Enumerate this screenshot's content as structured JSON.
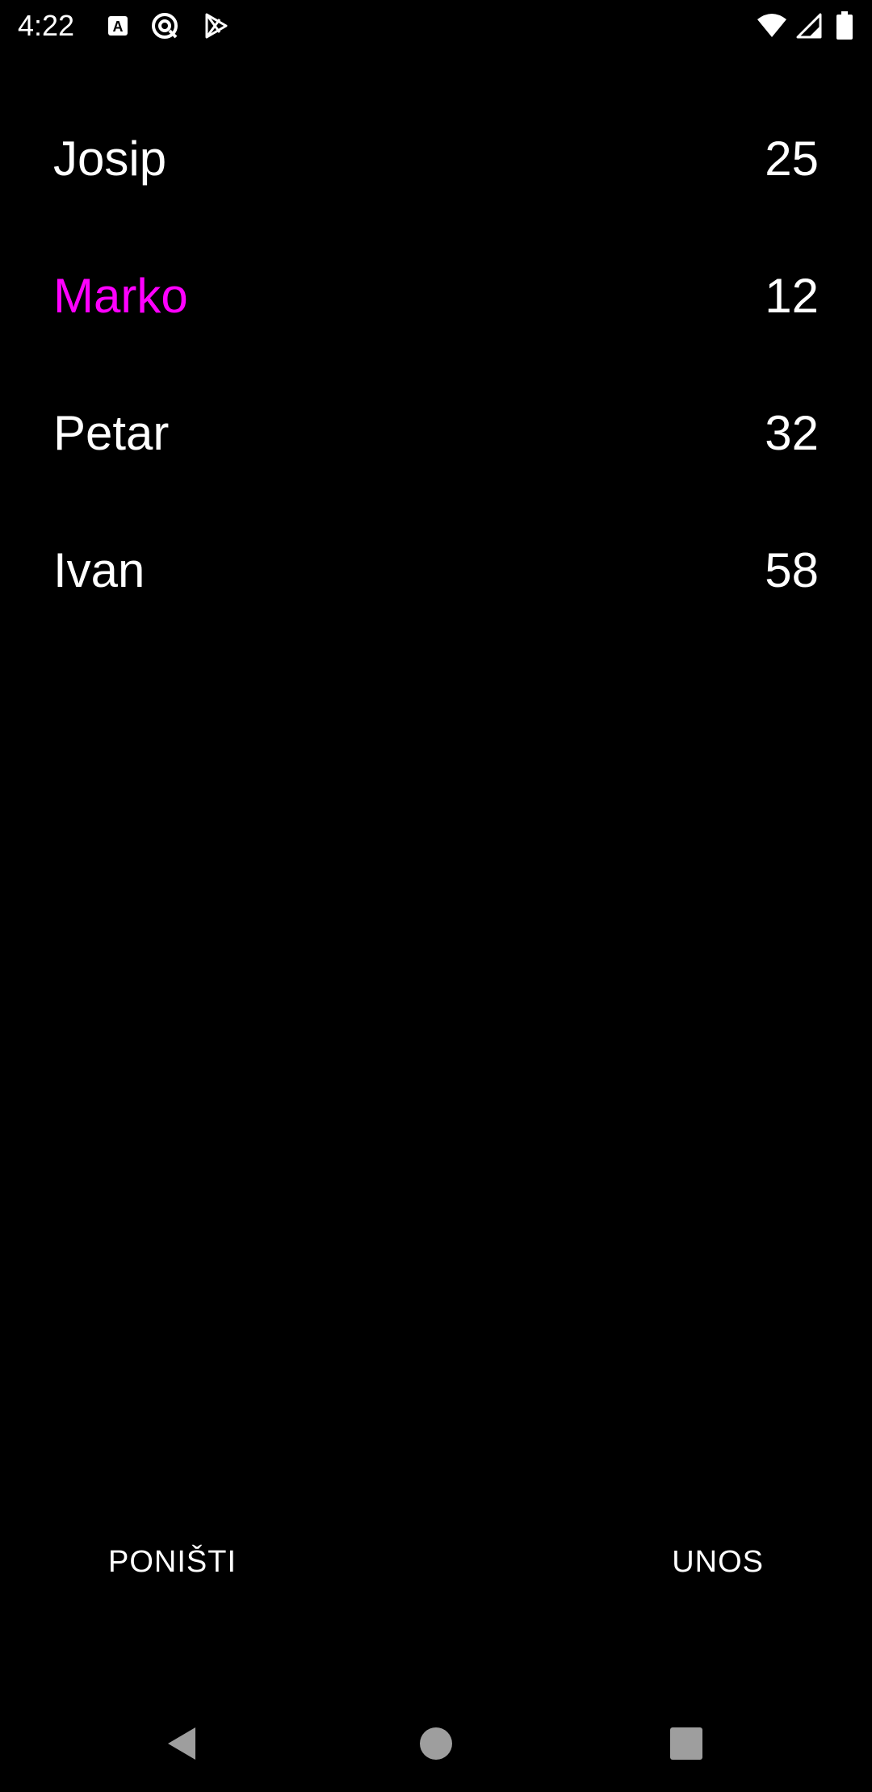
{
  "status_bar": {
    "time": "4:22",
    "left_icons": [
      "font-a-icon",
      "sync-blocked-icon",
      "play-store-icon"
    ],
    "right_icons": [
      "wifi-icon",
      "cell-signal-icon",
      "battery-icon"
    ]
  },
  "list": {
    "items": [
      {
        "name": "Josip",
        "value": "25",
        "color": "#ffffff"
      },
      {
        "name": "Marko",
        "value": "12",
        "color": "#ff00ff"
      },
      {
        "name": "Petar",
        "value": "32",
        "color": "#ffffff"
      },
      {
        "name": "Ivan",
        "value": "58",
        "color": "#ffffff"
      }
    ]
  },
  "buttons": {
    "cancel_label": "PONIŠTI",
    "submit_label": "UNOS"
  },
  "nav_bar": {
    "icons": [
      "back-icon",
      "home-icon",
      "recents-icon"
    ],
    "color": "#9e9e9e"
  },
  "colors": {
    "background": "#000000",
    "text": "#ffffff",
    "highlight": "#ff00ff"
  }
}
